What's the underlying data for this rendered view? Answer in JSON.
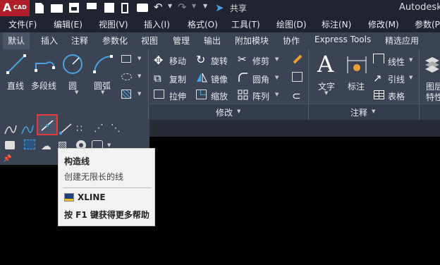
{
  "title": {
    "logo": "A",
    "logo_sub": "CAD",
    "share": "共享",
    "app": "Autodesk"
  },
  "menus": [
    "文件(F)",
    "编辑(E)",
    "视图(V)",
    "插入(I)",
    "格式(O)",
    "工具(T)",
    "绘图(D)",
    "标注(N)",
    "修改(M)",
    "参数(P"
  ],
  "tabs": [
    "默认",
    "插入",
    "注释",
    "参数化",
    "视图",
    "管理",
    "输出",
    "附加模块",
    "协作",
    "Express Tools",
    "精选应用"
  ],
  "draw": {
    "line": "直线",
    "polyline": "多段线",
    "circle": "圆",
    "arc": "圆弧"
  },
  "modify": {
    "move": "移动",
    "rotate": "旋转",
    "trim": "修剪",
    "copy": "复制",
    "mirror": "镜像",
    "fillet": "圆角",
    "stretch": "拉伸",
    "scale": "缩放",
    "array": "阵列",
    "panel": "修改"
  },
  "annot": {
    "text": "文字",
    "dim": "标注",
    "linear": "线性",
    "leader": "引线",
    "table": "表格",
    "panel": "注释"
  },
  "layer": {
    "line1": "图层",
    "line2": "特性"
  },
  "tooltip": {
    "title": "构造线",
    "desc": "创建无限长的线",
    "command": "XLINE",
    "help": "按 F1 键获得更多帮助"
  },
  "colors": {
    "accent": "#cf2230",
    "highlight": "#e23b3b",
    "ribbon": "#3b4454"
  }
}
